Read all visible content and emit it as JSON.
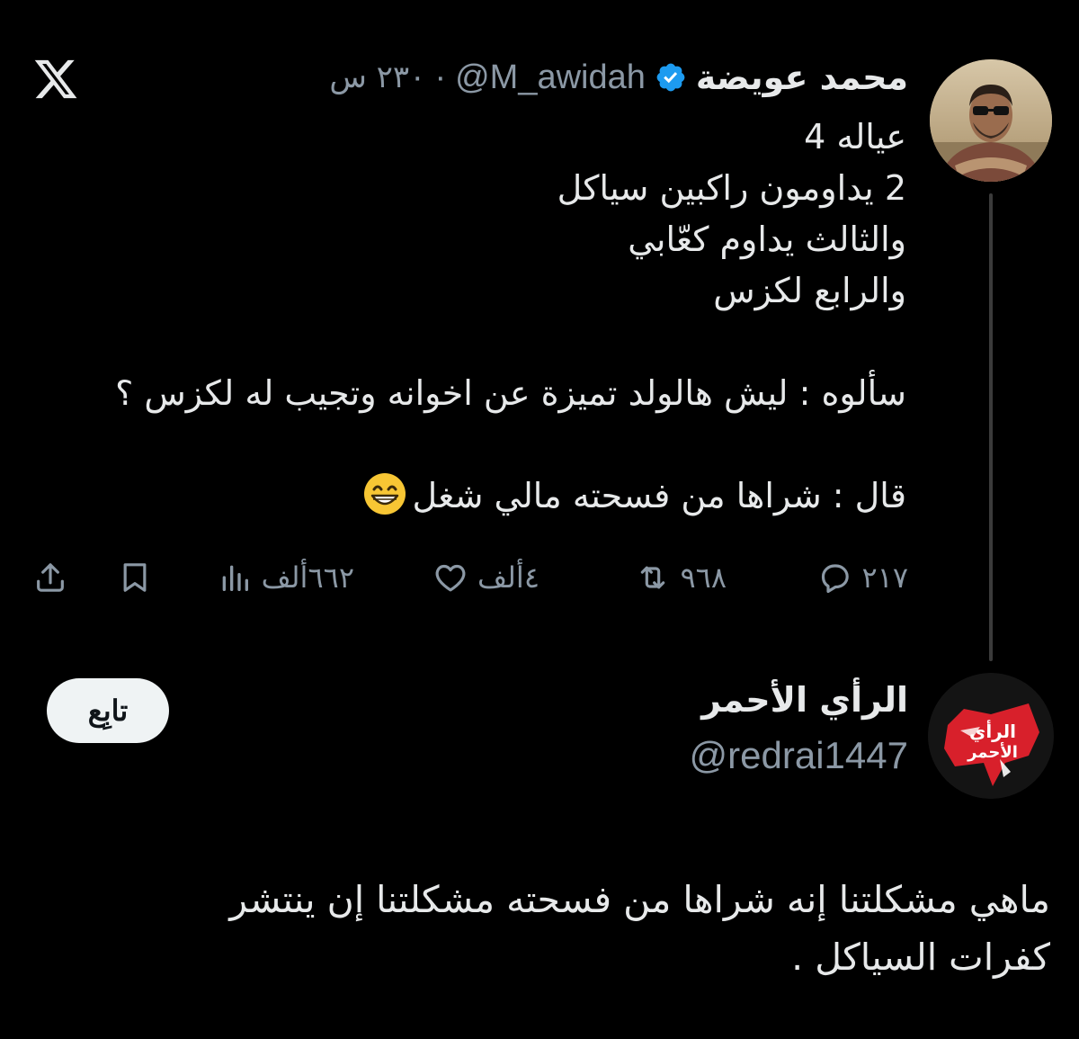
{
  "tweet": {
    "display_name": "محمد عويضة",
    "handle": "@M_awidah",
    "time": "٢٣٠ س",
    "separator": "·",
    "lines": [
      "عياله 4",
      "2 يداومون راكبين سياكل",
      "والثالث يداوم كعّابي",
      "والرابع لكزس",
      "",
      "سألوه : ليش هالولد تميزة عن اخوانه وتجيب له لكزس ؟",
      "",
      "قال : شراها من فسحته مالي شغل"
    ],
    "actions": {
      "replies": "٢١٧",
      "reposts": "٩٦٨",
      "likes": "٤ألف",
      "views": "٦٦٢ألف"
    }
  },
  "reply": {
    "display_name": "الرأي الأحمر",
    "handle": "@redrai1447",
    "follow_label": "تابِع",
    "lines": [
      "ماهي مشكلتنا إنه شراها من فسحته مشكلتنا إن ينتشر",
      "كفرات السياكل ."
    ]
  },
  "colors": {
    "background": "#000000",
    "text": "#e7e9ea",
    "muted": "#8b98a5",
    "verified": "#1d9bf0",
    "brand_red": "#d8202b"
  },
  "icons": [
    "x-logo-icon",
    "verified-icon",
    "reply-icon",
    "repost-icon",
    "like-icon",
    "views-icon",
    "bookmark-icon",
    "share-icon",
    "grinning-emoji-icon"
  ]
}
